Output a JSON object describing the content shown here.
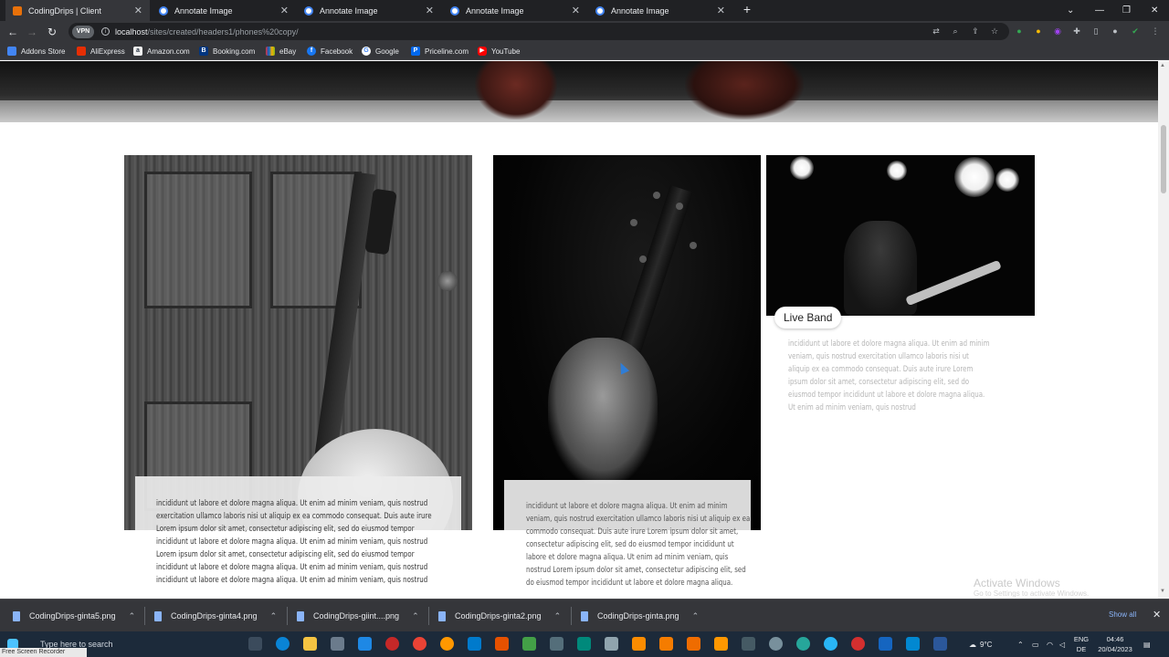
{
  "browser": {
    "tabs": [
      {
        "title": "CodingDrips | Client",
        "active": true
      },
      {
        "title": "Annotate Image",
        "active": false
      },
      {
        "title": "Annotate Image",
        "active": false
      },
      {
        "title": "Annotate Image",
        "active": false
      },
      {
        "title": "Annotate Image",
        "active": false
      }
    ],
    "new_tab": "+",
    "address": {
      "badge": "VPN",
      "host": "localhost",
      "path": "/sites/created/headers1/phones%20copy/"
    },
    "bookmarks": [
      {
        "label": "Addons Store",
        "icon": "grid-icon",
        "color": "#4285f4"
      },
      {
        "label": "AliExpress",
        "icon": "aliexpress-icon",
        "color": "#e62e04"
      },
      {
        "label": "Amazon.com",
        "icon": "amazon-icon",
        "color": "#232f3e"
      },
      {
        "label": "Booking.com",
        "icon": "booking-icon",
        "color": "#003580"
      },
      {
        "label": "eBay",
        "icon": "ebay-icon",
        "color": "#e53238"
      },
      {
        "label": "Facebook",
        "icon": "facebook-icon",
        "color": "#1877f2"
      },
      {
        "label": "Google",
        "icon": "google-icon",
        "color": "#ffffff"
      },
      {
        "label": "Priceline.com",
        "icon": "priceline-icon",
        "color": "#0068ef"
      },
      {
        "label": "YouTube",
        "icon": "youtube-icon",
        "color": "#ff0000"
      }
    ]
  },
  "page": {
    "card1_text": "incididunt ut labore et dolore magna aliqua. Ut enim ad minim veniam, quis nostrud exercitation ullamco laboris nisi ut aliquip ex ea commodo consequat. Duis aute irure Lorem ipsum dolor sit amet, consectetur adipiscing elit, sed do eiusmod tempor incididunt ut labore et dolore magna aliqua. Ut enim ad minim veniam, quis nostrud Lorem ipsum dolor sit amet, consectetur adipiscing elit, sed do eiusmod tempor incididunt ut labore et dolore magna aliqua. Ut enim ad minim veniam, quis nostrud incididunt ut labore et dolore magna aliqua. Ut enim ad minim veniam, quis nostrud",
    "card2_text": "incididunt ut labore et dolore magna aliqua. Ut enim ad minim veniam, quis nostrud exercitation ullamco laboris nisi ut aliquip ex ea commodo consequat. Duis aute irure Lorem ipsum dolor sit amet, consectetur adipiscing elit, sed do eiusmod tempor incididunt ut labore et dolore magna aliqua. Ut enim ad minim veniam, quis nostrud Lorem ipsum dolor sit amet, consectetur adipiscing elit, sed do eiusmod tempor incididunt ut labore et dolore magna aliqua.",
    "card3_label": "Live Band",
    "card3_text": "incididunt ut labore et dolore magna aliqua. Ut enim ad minim veniam, quis nostrud exercitation ullamco laboris nisi ut aliquip ex ea commodo consequat. Duis aute irure Lorem ipsum dolor sit amet, consectetur adipiscing elit, sed do eiusmod tempor incididunt ut labore et dolore magna aliqua. Ut enim ad minim veniam, quis nostrud",
    "watermark_title": "Activate Windows",
    "watermark_sub": "Go to Settings to activate Windows."
  },
  "downloads": {
    "items": [
      "CodingDrips-ginta5.png",
      "CodingDrips-ginta4.png",
      "CodingDrips-giint....png",
      "CodingDrips-ginta2.png",
      "CodingDrips-ginta.png"
    ],
    "show_all": "Show all"
  },
  "taskbar": {
    "search_placeholder": "Type here to search",
    "recorder_label": "Free Screen Recorder",
    "weather": "9°C",
    "lang_top": "ENG",
    "lang_bottom": "DE",
    "time": "04:46",
    "date": "20/04/2023"
  }
}
